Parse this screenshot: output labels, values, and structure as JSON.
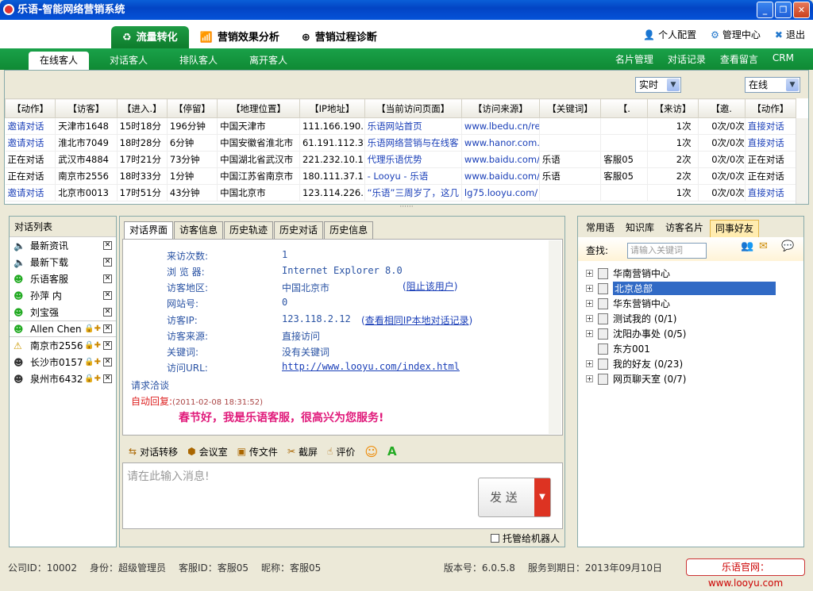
{
  "window": {
    "title": "乐语-智能网络营销系统",
    "buttons": [
      "_",
      "❐",
      "✕"
    ]
  },
  "topnav": {
    "tabs": [
      {
        "label": "流量转化",
        "icon": "recycle-icon"
      },
      {
        "label": "营销效果分析",
        "icon": "chart-icon"
      },
      {
        "label": "营销过程诊断",
        "icon": "plus-icon"
      }
    ],
    "links": [
      {
        "label": "个人配置",
        "icon": "person-icon"
      },
      {
        "label": "管理中心",
        "icon": "gear-icon"
      },
      {
        "label": "退出",
        "icon": "close-icon"
      }
    ]
  },
  "subnav": {
    "tabs": [
      "在线客人",
      "对话客人",
      "排队客人",
      "离开客人"
    ],
    "links": [
      "名片管理",
      "对话记录",
      "查看留言",
      "CRM"
    ]
  },
  "filters": {
    "mode": "实时",
    "status": "在线"
  },
  "visitor_table": {
    "headers": [
      "【动作】",
      "【访客】",
      "【进入.】",
      "【停留】",
      "【地理位置】",
      "【IP地址】",
      "【当前访问页面】",
      "【访问来源】",
      "【关键词】",
      "【.",
      "【来访】",
      "【邀.",
      "【动作】"
    ],
    "rows": [
      [
        "邀请对话",
        "天津市1648",
        "15时18分",
        "196分钟",
        "中国天津市",
        "111.166.190.1",
        "乐语网站首页",
        "www.lbedu.cn/re",
        "",
        "",
        "1次",
        "0次/0次",
        "直接对话"
      ],
      [
        "邀请对话",
        "淮北市7049",
        "18时28分",
        "6分钟",
        "中国安徽省淮北市",
        "61.191.112.37",
        "乐语网络营销与在线客",
        "www.hanor.com.",
        "",
        "",
        "1次",
        "0次/0次",
        "直接对话"
      ],
      [
        "正在对话",
        "武汉市4884",
        "17时21分",
        "73分钟",
        "中国湖北省武汉市",
        "221.232.10.1",
        "代理乐语优势",
        "www.baidu.com/",
        "乐语",
        "客服05",
        "2次",
        "0次/0次",
        "正在对话"
      ],
      [
        "正在对话",
        "南京市2556",
        "18时33分",
        "1分钟",
        "中国江苏省南京市",
        "180.111.37.1",
        "- Looyu - 乐语",
        "www.baidu.com/",
        "乐语",
        "客服05",
        "2次",
        "0次/0次",
        "正在对话"
      ],
      [
        "邀请对话",
        "北京市0013",
        "17时51分",
        "43分钟",
        "中国北京市",
        "123.114.226.1",
        "“乐语”三周岁了，这几",
        "lg75.looyu.com/",
        "",
        "",
        "1次",
        "0次/0次",
        "直接对话"
      ]
    ]
  },
  "conv_list": {
    "title": "对话列表",
    "items": [
      {
        "label": "最新资讯",
        "icon": "speaker-icon"
      },
      {
        "label": "最新下载",
        "icon": "speaker-icon"
      },
      {
        "label": "乐语客服",
        "icon": "green-user-icon"
      },
      {
        "label": "孙萍 内",
        "icon": "green-user-icon"
      },
      {
        "label": "刘宝强",
        "icon": "green-user-icon"
      },
      {
        "label": "Allen Chen",
        "icon": "green-user-icon"
      },
      {
        "label": "南京市2556",
        "icon": "alert-user-icon"
      },
      {
        "label": "长沙市0157",
        "icon": "dark-user-icon"
      },
      {
        "label": "泉州市6432",
        "icon": "dark-user-icon"
      }
    ]
  },
  "chat_tabs": [
    "对话界面",
    "访客信息",
    "历史轨迹",
    "历史对话",
    "历史信息"
  ],
  "visitor_info": {
    "labels": [
      "来访次数:",
      "浏 览 器:",
      "访客地区:",
      "网站号:",
      "访客IP:",
      "访客来源:",
      "关键词:",
      "访问URL:"
    ],
    "values": [
      "1",
      "Internet Explorer 8.0",
      "中国北京市",
      "0",
      "123.118.2.12",
      "直接访问",
      "没有关键词",
      "http://www.looyu.com/index.html"
    ],
    "block_link": "阻止该用户",
    "ip_link": "查看相同IP本地对话记录"
  },
  "messages": {
    "request": "请求洽谈",
    "auto_label": "自动回复:",
    "auto_time": "(2011-02-08 18:31:52)",
    "auto_text": "春节好，我是乐语客服，很高兴为您服务!"
  },
  "chat_tools": [
    "对话转移",
    "会议室",
    "传文件",
    "截屏",
    "评价"
  ],
  "input": {
    "placeholder": "请在此输入消息!",
    "send": "发 送",
    "robot": "托管给机器人"
  },
  "right_tabs": [
    "常用语",
    "知识库",
    "访客名片",
    "同事好友"
  ],
  "search": {
    "label": "查找:",
    "placeholder": "请输入关键词"
  },
  "tree": [
    "华南营销中心",
    "北京总部",
    "华东营销中心",
    "测试我的 (0/1)",
    "沈阳办事处 (0/5)",
    "东方001",
    "我的好友 (0/23)",
    "网页聊天室 (0/7)"
  ],
  "status": {
    "company": "公司ID：10002",
    "role": "身份：超级管理员",
    "agent": "客服ID：客服05",
    "nick": "昵称：客服05",
    "version": "版本号：6.0.5.8",
    "expire": "服务到期日：2013年09月10日",
    "site": "乐语官网：www.looyu.com"
  }
}
